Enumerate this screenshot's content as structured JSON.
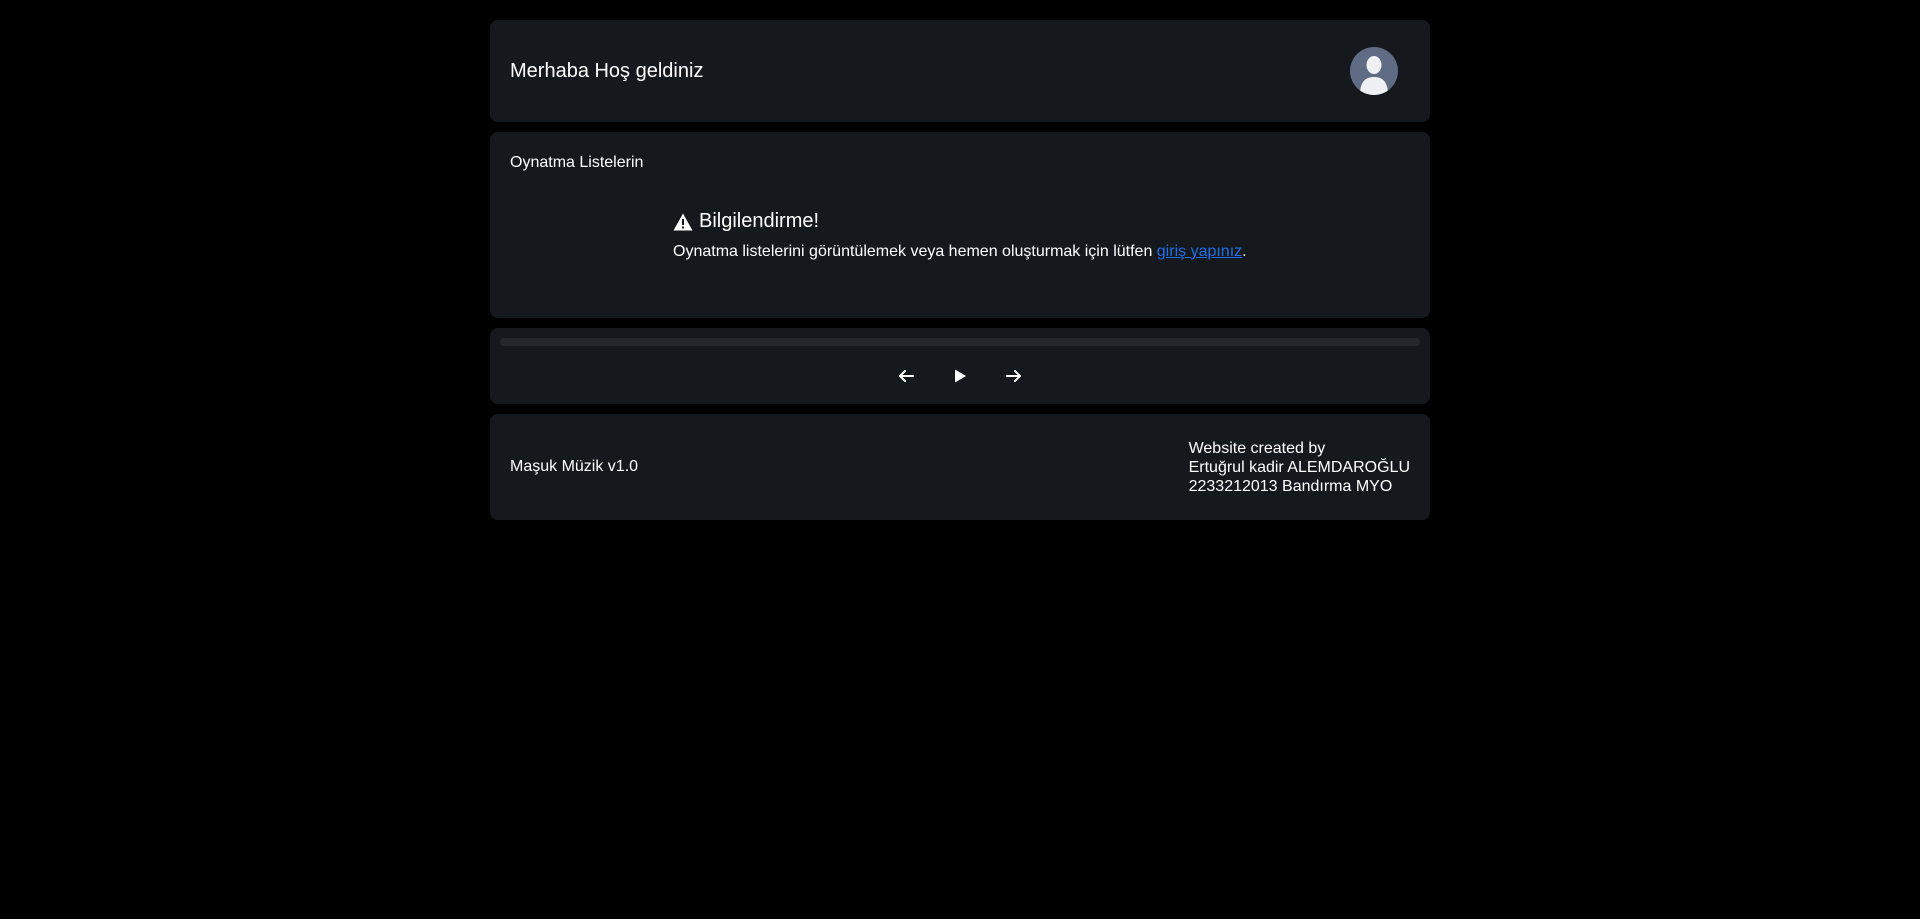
{
  "header": {
    "greeting": "Merhaba Hoş geldiniz",
    "avatar_icon": "user-avatar-icon"
  },
  "playlists": {
    "title": "Oynatma Listelerin",
    "alert": {
      "icon": "warning-icon",
      "heading": "Bilgilendirme!",
      "text_before": "Oynatma listelerini görüntülemek veya hemen oluşturmak için lütfen ",
      "link_text": "giriş yapınız",
      "text_after": "."
    }
  },
  "player": {
    "progress": 0,
    "controls": {
      "prev_icon": "arrow-left-icon",
      "play_icon": "play-icon",
      "next_icon": "arrow-right-icon"
    }
  },
  "footer": {
    "brand": "Maşuk Müzik v1.0",
    "credits": [
      "Website created by",
      "Ertuğrul kadir ALEMDAROĞLU",
      "2233212013 Bandırma MYO"
    ]
  },
  "colors": {
    "page_bg": "#000000",
    "card_bg": "#15181c",
    "link": "#1f6feb",
    "avatar_bg": "#5f6c84",
    "progress_track": "#24272c"
  }
}
